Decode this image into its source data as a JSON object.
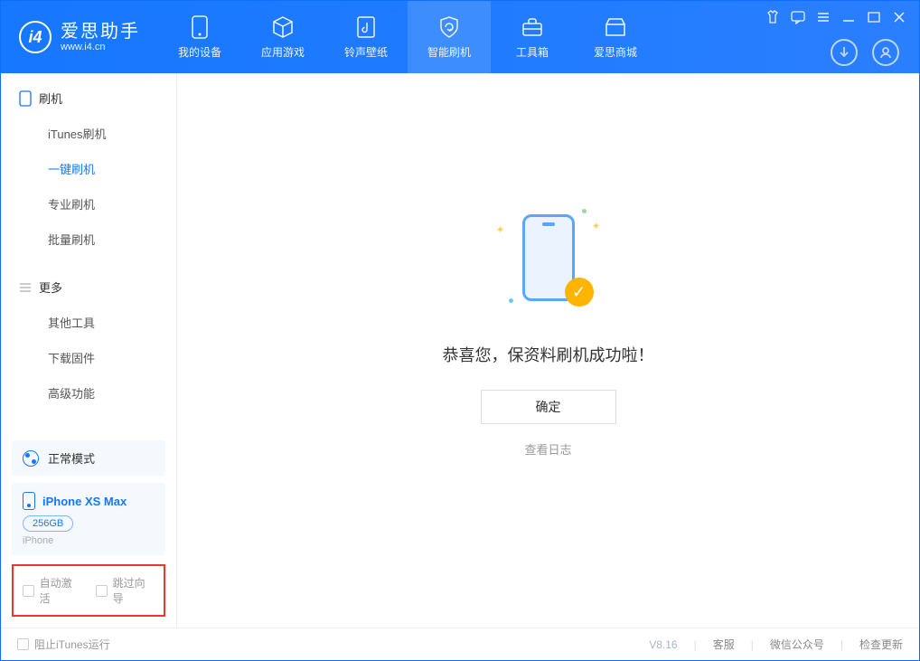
{
  "header": {
    "brand_title": "爱思助手",
    "brand_url": "www.i4.cn",
    "tabs": [
      {
        "label": "我的设备"
      },
      {
        "label": "应用游戏"
      },
      {
        "label": "铃声壁纸"
      },
      {
        "label": "智能刷机"
      },
      {
        "label": "工具箱"
      },
      {
        "label": "爱思商城"
      }
    ]
  },
  "sidebar": {
    "sections": [
      {
        "title": "刷机",
        "items": [
          "iTunes刷机",
          "一键刷机",
          "专业刷机",
          "批量刷机"
        ]
      },
      {
        "title": "更多",
        "items": [
          "其他工具",
          "下载固件",
          "高级功能"
        ]
      }
    ],
    "mode": "正常模式",
    "device": {
      "name": "iPhone XS Max",
      "capacity": "256GB",
      "type": "iPhone"
    },
    "checkboxes": [
      "自动激活",
      "跳过向导"
    ]
  },
  "main": {
    "success_message": "恭喜您，保资料刷机成功啦！",
    "ok_button": "确定",
    "view_log": "查看日志"
  },
  "statusbar": {
    "block_itunes": "阻止iTunes运行",
    "version": "V8.16",
    "links": [
      "客服",
      "微信公众号",
      "检查更新"
    ]
  }
}
